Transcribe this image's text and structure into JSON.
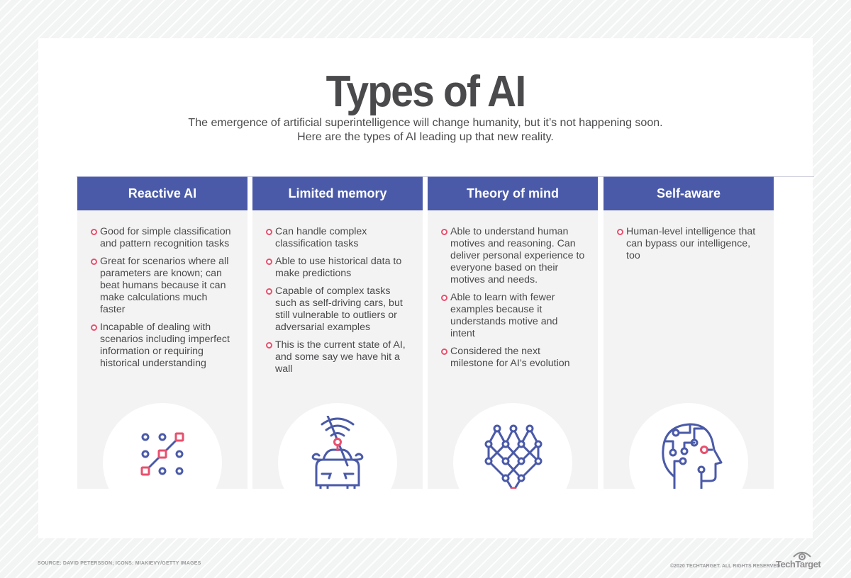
{
  "header": {
    "title": "Types of AI",
    "subtitle_line1": "The emergence of artificial superintelligence will change humanity, but it’s not happening soon.",
    "subtitle_line2": "Here are the types of AI leading up that new reality."
  },
  "colors": {
    "header_blue": "#4a5aa8",
    "bullet_pink": "#e8506e",
    "icon_blue": "#4a5aa8",
    "panel_gray": "#f3f3f3",
    "text_gray": "#4a4a4c"
  },
  "columns": [
    {
      "title": "Reactive AI",
      "icon": "pattern-grid-icon",
      "bullets": [
        "Good for simple classification and pattern recognition tasks",
        "Great for scenarios where all parameters are known; can beat humans because it can make calculations much faster",
        "Incapable of dealing with scenarios including imperfect information or requiring historical understanding"
      ]
    },
    {
      "title": "Limited memory",
      "icon": "self-driving-car-icon",
      "bullets": [
        "Can handle complex classification tasks",
        "Able to use historical data to make predictions",
        "Capable of complex tasks such as self-driving cars, but still vulnerable to outliers or adversarial examples",
        "This is the current state of AI, and some say we have hit a wall"
      ]
    },
    {
      "title": "Theory of mind",
      "icon": "neural-network-icon",
      "bullets": [
        "Able to understand human motives and reasoning. Can deliver personal experience to everyone based on their motives and needs.",
        "Able to learn with fewer examples because it understands motive and intent",
        "Considered the next milestone for AI’s evolution"
      ]
    },
    {
      "title": "Self-aware",
      "icon": "circuit-head-icon",
      "bullets": [
        "Human-level intelligence that can bypass our intelligence, too"
      ]
    }
  ],
  "footer": {
    "source": "SOURCE: DAVID PETERSSON; ICONS: MIAKIEVY/GETTY IMAGES",
    "copyright": "©2020 TECHTARGET. ALL RIGHTS RESERVED",
    "brand": "TechTarget"
  }
}
